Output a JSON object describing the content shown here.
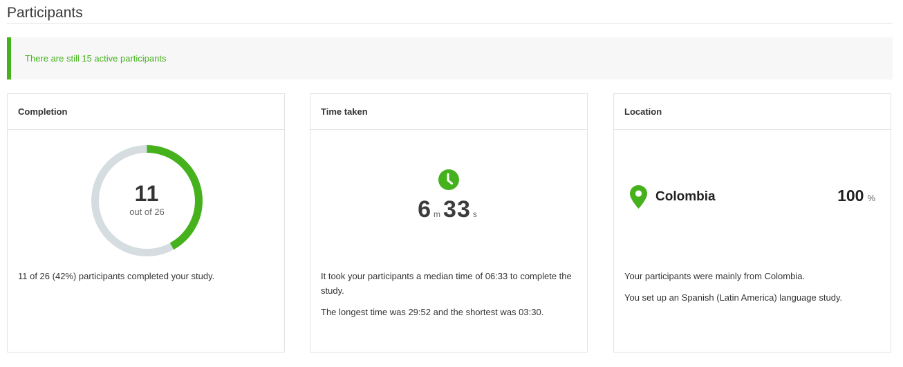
{
  "header": {
    "title": "Participants"
  },
  "alert": {
    "text": "There are still 15 active participants"
  },
  "completion": {
    "title": "Completion",
    "completed": "11",
    "out_of_label": "out of 26",
    "progress_fraction": 0.42,
    "summary": "11 of 26 (42%) participants completed your study.",
    "colors": {
      "progress": "#45b11c",
      "track": "#d5dde0"
    }
  },
  "time_taken": {
    "title": "Time taken",
    "icon": "clock-icon",
    "minutes": "6",
    "minutes_unit": "m",
    "seconds": "33",
    "seconds_unit": "s",
    "description_1": "It took your participants a median time of 06:33 to complete the study.",
    "description_2": "The longest time was 29:52 and the shortest was 03:30."
  },
  "location": {
    "title": "Location",
    "icon": "map-pin-icon",
    "country": "Colombia",
    "percent": "100",
    "percent_symbol": "%",
    "description_1": "Your participants were mainly from Colombia.",
    "description_2": "You set up an Spanish (Latin America) language study."
  },
  "colors": {
    "accent": "#45b11c"
  }
}
